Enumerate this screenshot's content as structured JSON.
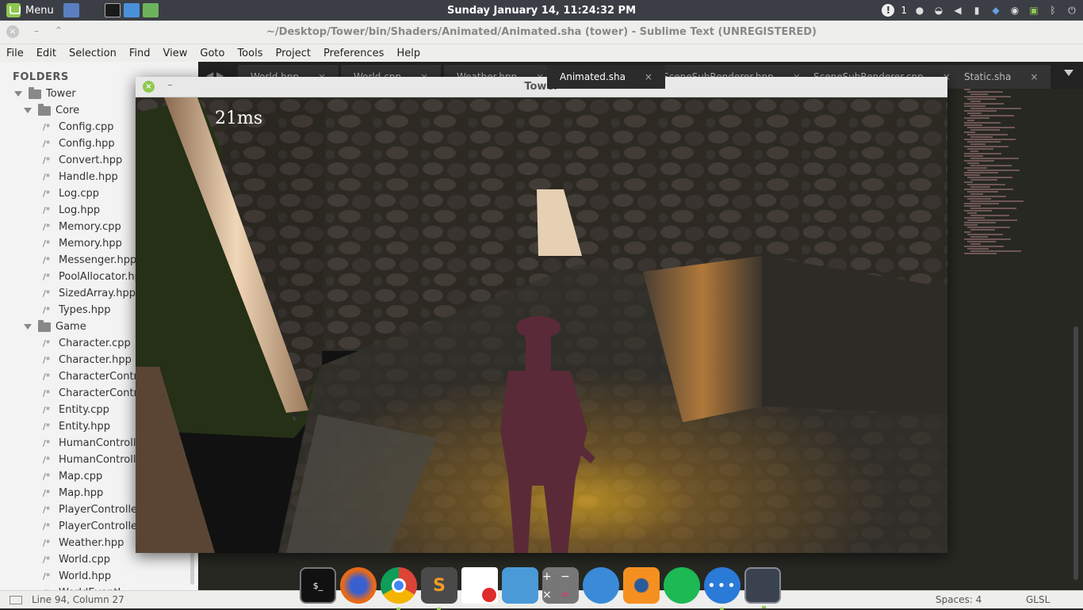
{
  "panel": {
    "menu_label": "Menu",
    "clock": "Sunday January 14, 11:24:32 PM",
    "workspace_count": "1"
  },
  "sublime": {
    "title": "~/Desktop/Tower/bin/Shaders/Animated/Animated.sha (tower) - Sublime Text (UNREGISTERED)",
    "menu": [
      "File",
      "Edit",
      "Selection",
      "Find",
      "View",
      "Goto",
      "Tools",
      "Project",
      "Preferences",
      "Help"
    ],
    "tabs": [
      {
        "label": "World.hpp",
        "active": false
      },
      {
        "label": "World.cpp",
        "active": false
      },
      {
        "label": "Weather.hpp",
        "active": false
      },
      {
        "label": "Animated.sha",
        "active": true
      },
      {
        "label": "SceneSubRenderer.hpp",
        "active": false
      },
      {
        "label": "SceneSubRenderer.cpp",
        "active": false
      },
      {
        "label": "Static.sha",
        "active": false
      }
    ],
    "tab_close_glyph": "×",
    "status": {
      "position": "Line 94, Column 27",
      "spaces": "Spaces: 4",
      "syntax": "GLSL"
    }
  },
  "sidebar": {
    "header": "FOLDERS",
    "root": "Tower",
    "folders": [
      {
        "name": "Core",
        "files": [
          "Config.cpp",
          "Config.hpp",
          "Convert.hpp",
          "Handle.hpp",
          "Log.cpp",
          "Log.hpp",
          "Memory.cpp",
          "Memory.hpp",
          "Messenger.hpp",
          "PoolAllocator.hpp",
          "SizedArray.hpp",
          "Types.hpp"
        ]
      },
      {
        "name": "Game",
        "files": [
          "Character.cpp",
          "Character.hpp",
          "CharacterControl",
          "CharacterControl",
          "Entity.cpp",
          "Entity.hpp",
          "HumanControlle",
          "HumanControlle",
          "Map.cpp",
          "Map.hpp",
          "PlayerController.",
          "PlayerController.",
          "Weather.hpp",
          "World.cpp",
          "World.hpp",
          "WorldEventL"
        ]
      }
    ],
    "file_glyph": "/*"
  },
  "game": {
    "title": "Tower",
    "frame_time": "21ms",
    "close_glyph": "×",
    "min_glyph": "–"
  },
  "dock": {
    "items": [
      "terminal",
      "firefox",
      "chrome",
      "sublime-text",
      "text-editor",
      "files",
      "calculator",
      "hexchat",
      "blender",
      "spotify",
      "messages",
      "window"
    ]
  },
  "colors": {
    "mint": "#8fc850",
    "panel": "#3b3f45",
    "editor_bg": "#272822"
  }
}
